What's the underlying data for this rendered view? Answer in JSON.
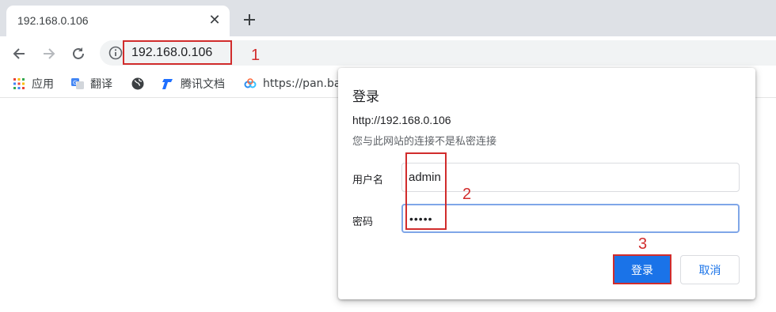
{
  "tab": {
    "title": "192.168.0.106",
    "close_icon": "close-icon",
    "new_tab_icon": "plus-icon"
  },
  "toolbar": {
    "back_icon": "arrow-left-icon",
    "forward_icon": "arrow-right-icon",
    "reload_icon": "reload-icon",
    "info_icon": "info-icon",
    "url": "192.168.0.106"
  },
  "bookmarks": [
    {
      "label": "应用",
      "icon": "apps-grid-icon"
    },
    {
      "label": "翻译",
      "icon": "translate-icon"
    },
    {
      "label": "",
      "icon": "globe-icon"
    },
    {
      "label": "腾讯文档",
      "icon": "tencent-docs-icon"
    },
    {
      "label": "https://pan.ba",
      "icon": "baidu-pan-icon"
    }
  ],
  "dialog": {
    "title": "登录",
    "url": "http://192.168.0.106",
    "note": "您与此网站的连接不是私密连接",
    "username_label": "用户名",
    "username_value": "admin",
    "password_label": "密码",
    "password_value": "•••••",
    "login_button": "登录",
    "cancel_button": "取消"
  },
  "annotations": {
    "step1": "1",
    "step2": "2",
    "step3": "3",
    "color": "#d12c2c"
  },
  "colors": {
    "accent": "#1a73e8",
    "tabstrip": "#dee1e6",
    "omnibox": "#f1f3f4"
  }
}
